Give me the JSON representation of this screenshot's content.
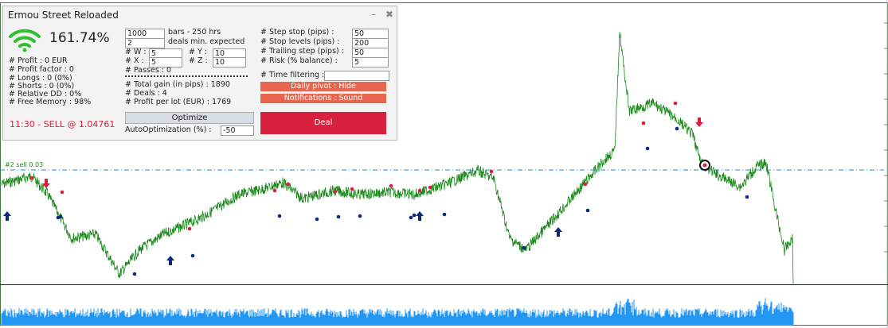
{
  "panel": {
    "title": "Ermou Street Reloaded",
    "minimize": "–",
    "close": "✖",
    "signal_icon": "wifi-signal-icon",
    "accent": "#2fbf2f",
    "percent": "161.74%",
    "stats": [
      "# Profit : 0 EUR",
      "# Profit factor : 0",
      "# Longs : 0 (0%)",
      "# Shorts : 0 (0%)",
      "# Relative DD : 0%",
      "# Free Memory : 98%"
    ],
    "status_line": "11:30 - SELL @ 1.04761",
    "bars_value": "1000",
    "bars_label": "bars - 250 hrs",
    "deals_value": "2",
    "deals_label": "deals min. expected",
    "w_label": "# W :",
    "w_value": "5",
    "y_label": "# Y :",
    "y_value": "10",
    "x_label": "# X :",
    "x_value": "5",
    "z_label": "# Z :",
    "z_value": "10",
    "passes": "# Passes : 0",
    "total_gain": "# Total gain (in pips) : 1890",
    "deals_count": "# Deals : 4",
    "profit_per_lot": "# Profit per lot (EUR) : 1769",
    "optimize_label": "Optimize",
    "autoopt_label": "AutoOptimization (%) :",
    "autoopt_value": "-50",
    "step_stop_label": "# Step stop (pips) :",
    "step_stop_value": "50",
    "stop_levels_label": "# Stop levels (pips) :",
    "stop_levels_value": "200",
    "trailing_label": "# Trailing step (pips) :",
    "trailing_value": "50",
    "risk_label": "# Risk (% balance) :",
    "risk_value": "5",
    "time_filter_label": "# Time filtering :",
    "time_filter_value": "",
    "daily_pivot_label": "Daily pivot : Hide",
    "notifications_label": "Notifications : Sound",
    "deal_label": "Deal",
    "deal_color": "#d9203f",
    "button_color": "#e8664e"
  },
  "chart": {
    "order_line_label": "#2 sell 0.03",
    "price_color": "#1b8a1b",
    "order_line_color": "#1e88e5",
    "volume_color": "#2196f3",
    "buy_arrow_color": "#0d2a7a",
    "sell_arrow_color": "#d9203f",
    "marker_icon": "sell-entry-marker-icon"
  }
}
